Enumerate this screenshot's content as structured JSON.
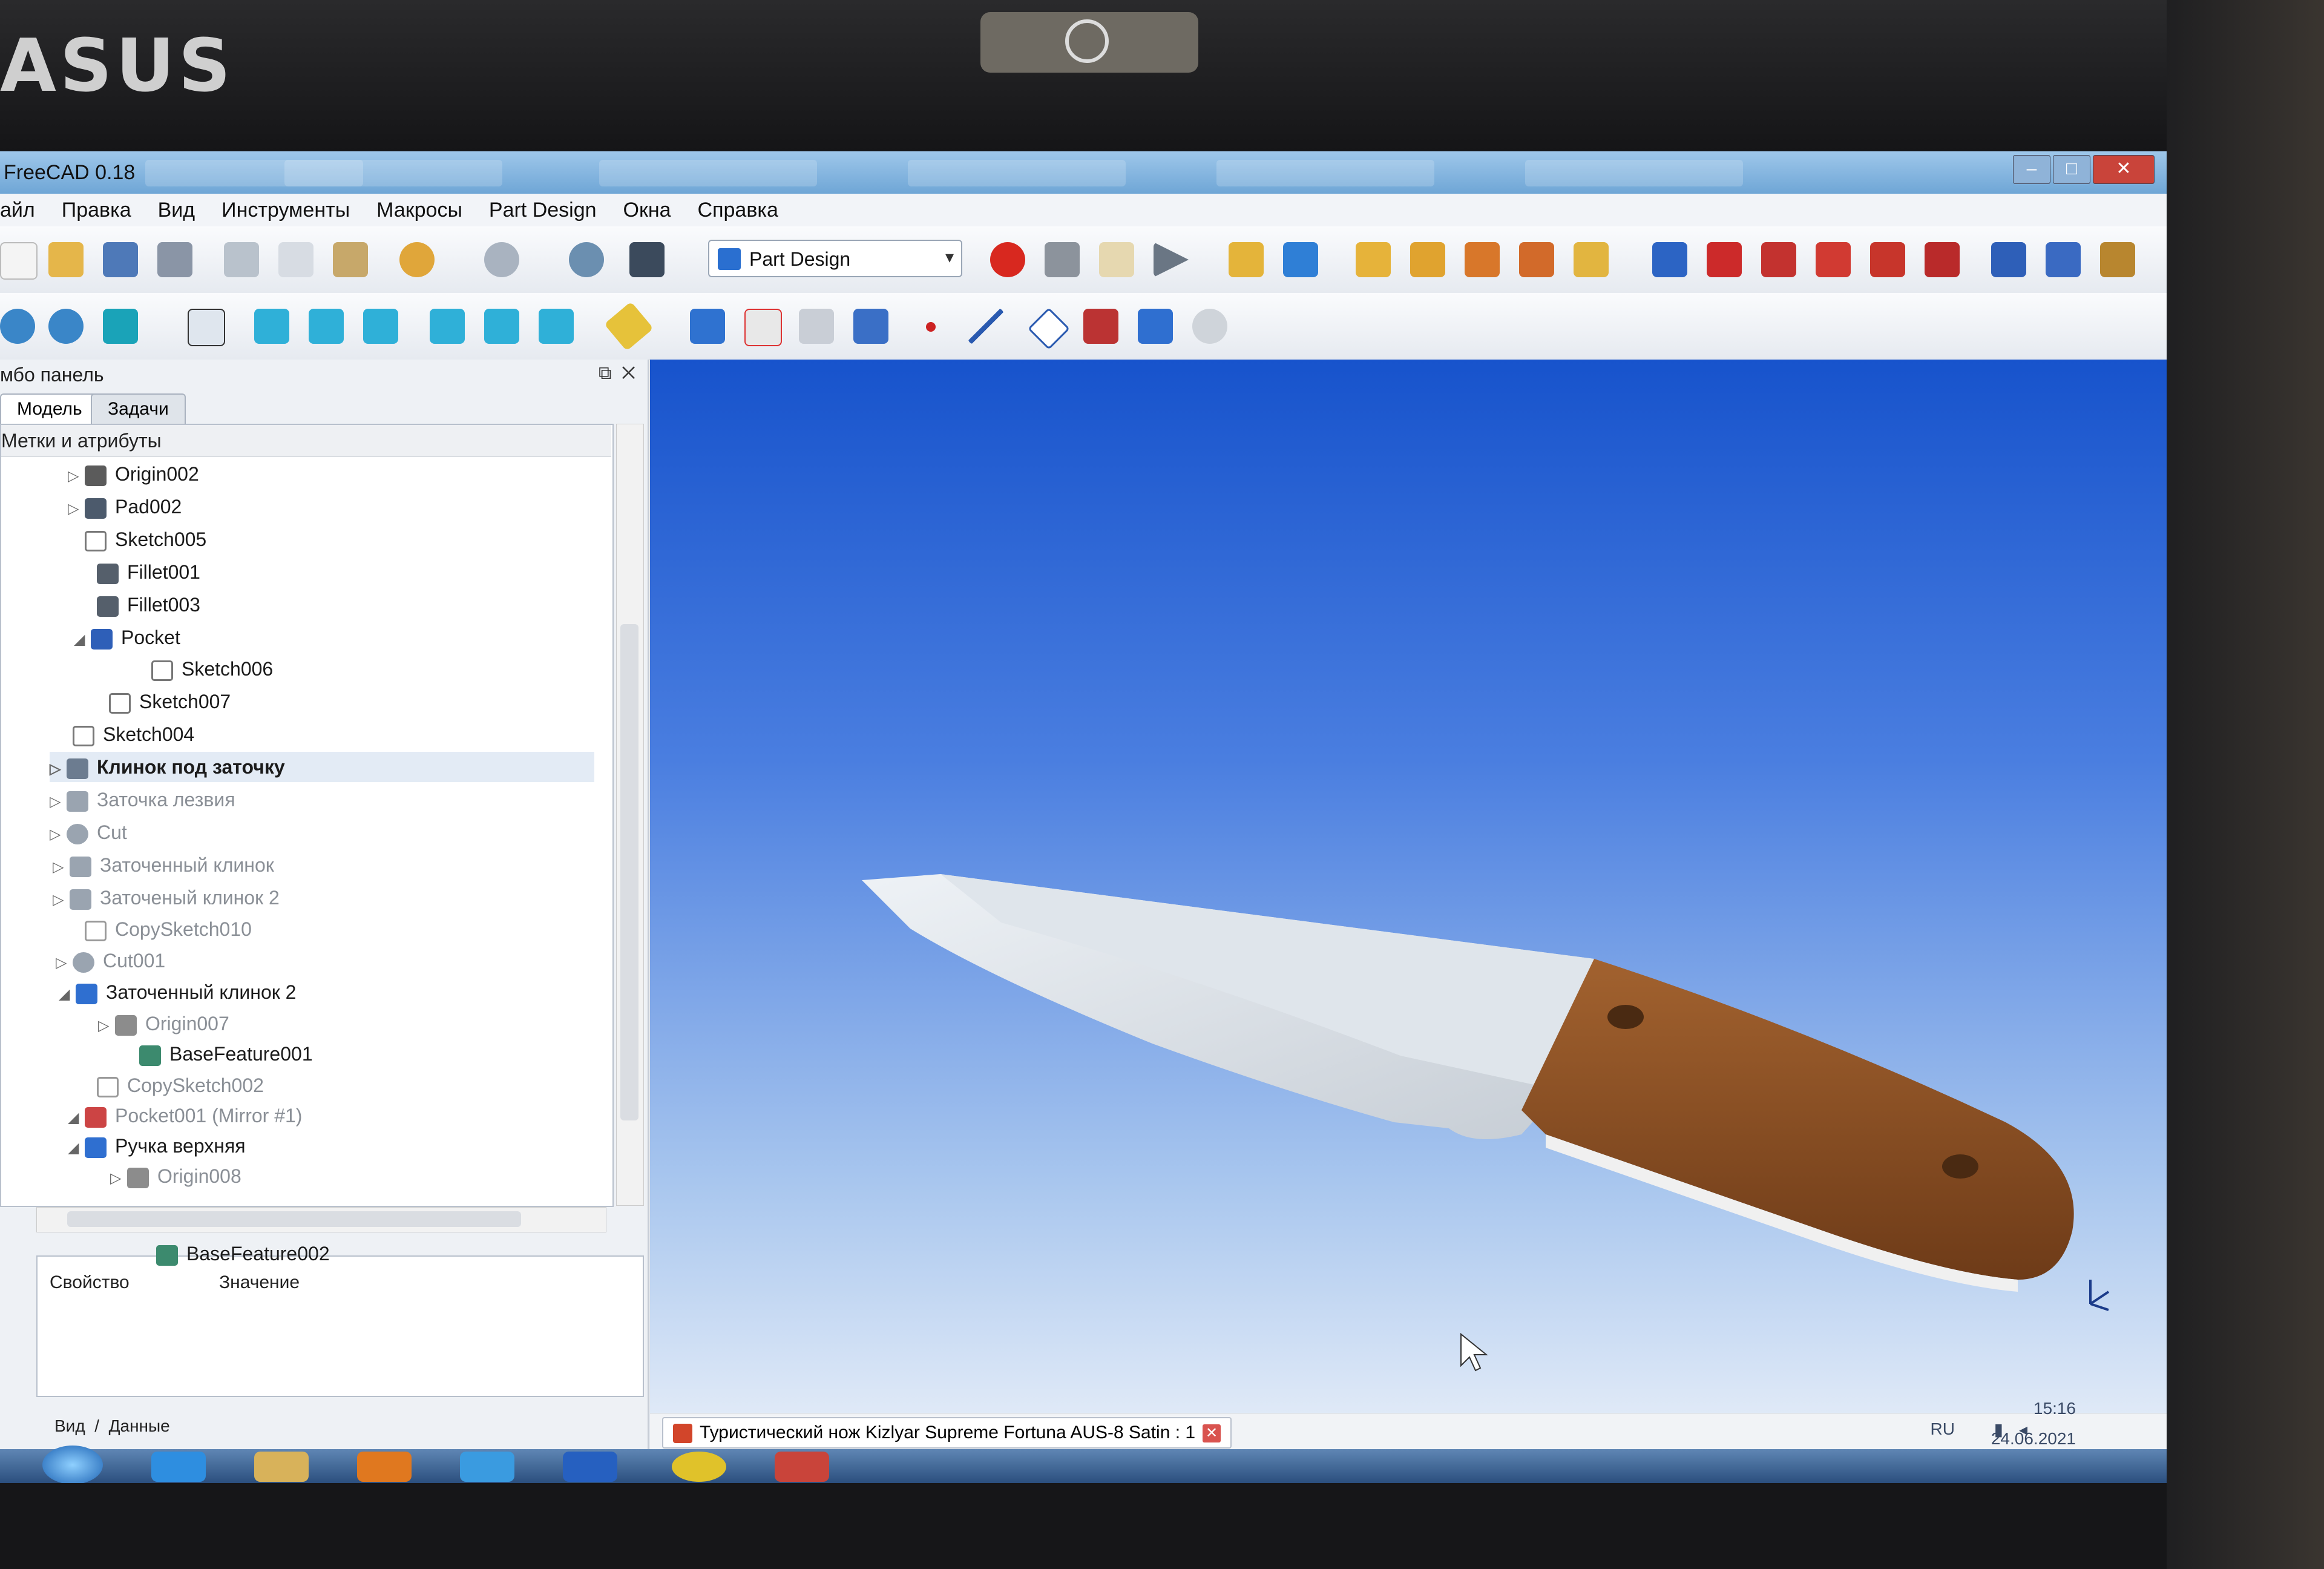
{
  "device": {
    "brand": "ASUS"
  },
  "window": {
    "title": "FreeCAD 0.18",
    "controls": {
      "minimize": "–",
      "maximize": "□",
      "close": "✕"
    }
  },
  "menu": [
    "айл",
    "Правка",
    "Вид",
    "Инструменты",
    "Макросы",
    "Part Design",
    "Окна",
    "Справка"
  ],
  "workbench": {
    "selected": "Part Design"
  },
  "combo_panel": {
    "title": "мбо панель",
    "tabs": [
      "Модель",
      "Задачи"
    ],
    "active_tab": "Модель",
    "tree_header": "Метки и атрибуты",
    "tree": [
      {
        "label": "Origin002",
        "icon": "origin-icon",
        "toggle": "▷"
      },
      {
        "label": "Pad002",
        "icon": "pad-icon",
        "toggle": "▷"
      },
      {
        "label": "Sketch005",
        "icon": "sketch-icon",
        "toggle": ""
      },
      {
        "label": "Fillet001",
        "icon": "fillet-icon",
        "toggle": ""
      },
      {
        "label": "Fillet003",
        "icon": "fillet-icon",
        "toggle": ""
      },
      {
        "label": "Pocket",
        "icon": "pocket-icon",
        "toggle": "◢"
      },
      {
        "label": "Sketch006",
        "icon": "sketch-icon",
        "toggle": ""
      },
      {
        "label": "Sketch007",
        "icon": "sketch-icon",
        "toggle": ""
      },
      {
        "label": "Sketch004",
        "icon": "sketch-icon",
        "toggle": ""
      },
      {
        "label": "Клинок под заточку",
        "icon": "body-icon",
        "toggle": "▷"
      },
      {
        "label": "Заточка лезвия",
        "icon": "body-icon",
        "toggle": "▷"
      },
      {
        "label": "Cut",
        "icon": "cut-icon",
        "toggle": "▷"
      },
      {
        "label": "Заточенный клинок",
        "icon": "body-icon",
        "toggle": "▷"
      },
      {
        "label": "Заточеный клинок 2",
        "icon": "body-icon",
        "toggle": "▷"
      },
      {
        "label": "CopySketch010",
        "icon": "sketch-icon",
        "toggle": ""
      },
      {
        "label": "Cut001",
        "icon": "cut-icon",
        "toggle": "▷"
      },
      {
        "label": "Заточенный клинок 2",
        "icon": "body-icon",
        "toggle": "◢"
      },
      {
        "label": "Origin007",
        "icon": "origin-icon",
        "toggle": "▷"
      },
      {
        "label": "BaseFeature001",
        "icon": "basefeature-icon",
        "toggle": ""
      },
      {
        "label": "CopySketch002",
        "icon": "sketch-icon",
        "toggle": ""
      },
      {
        "label": "Pocket001 (Mirror #1)",
        "icon": "mirror-icon",
        "toggle": "◢"
      },
      {
        "label": "Ручка верхняя",
        "icon": "body-icon",
        "toggle": "◢"
      },
      {
        "label": "Origin008",
        "icon": "origin-icon",
        "toggle": "▷"
      },
      {
        "label": "BaseFeature002",
        "icon": "basefeature-icon",
        "toggle": ""
      }
    ],
    "property_headers": {
      "property": "Свойство",
      "value": "Значение"
    },
    "bottom_tabs": [
      "Вид",
      "Данные"
    ]
  },
  "document": {
    "tab_label": "Туристический нож Kizlyar Supreme Fortuna AUS-8 Satin : 1"
  },
  "system_tray": {
    "language": "RU",
    "time": "15:16",
    "date": "24.06.2021"
  },
  "colors": {
    "title_bar": "#7fb0de",
    "view_top": "#1753cc",
    "view_bottom": "#dfe9f7",
    "blade": "#d7dde3",
    "handle": "#8a4f24",
    "record": "#d8281f"
  }
}
